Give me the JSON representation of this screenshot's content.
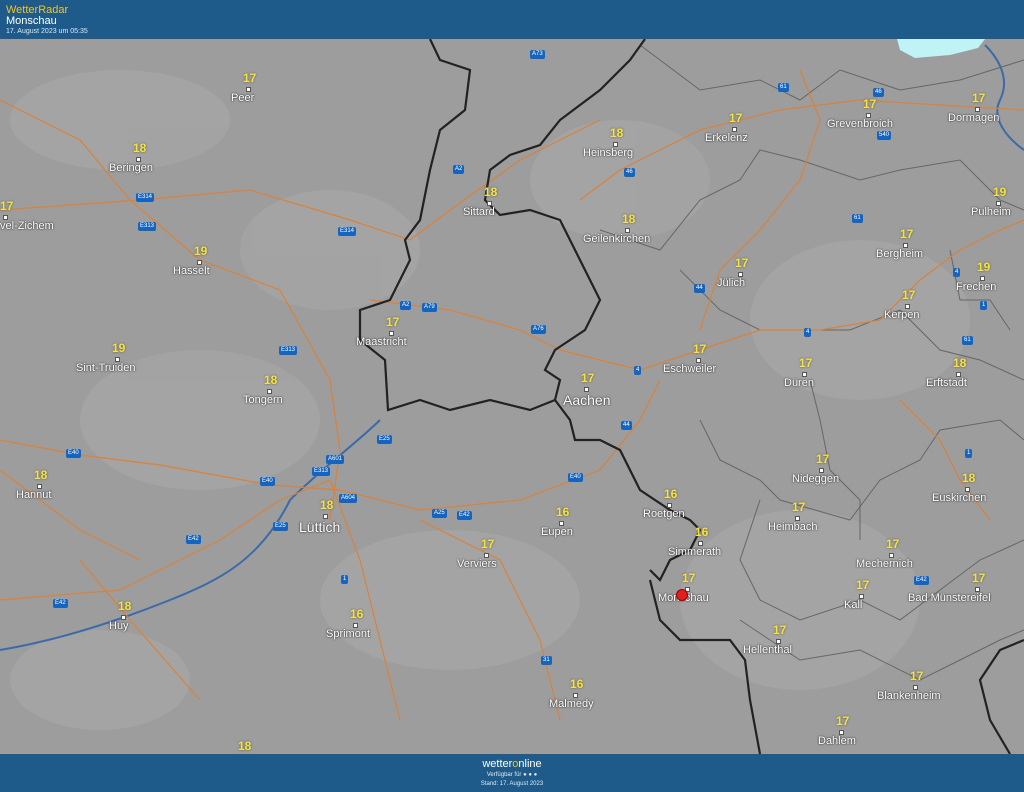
{
  "header": {
    "brand": "WetterRadar",
    "location": "Monschau",
    "timestamp": "17. August 2023 um 05:35"
  },
  "footer": {
    "logo_pre": "wetter",
    "logo_o": "o",
    "logo_post": "nline",
    "available": "Verfügbar für ● ● ●",
    "stand": "Stand: 17. August 2023"
  },
  "cities": [
    {
      "name": "Peer",
      "temp": "17"
    },
    {
      "name": "Beringen",
      "temp": "18"
    },
    {
      "name": "Heinsberg",
      "temp": "18"
    },
    {
      "name": "Erkelenz",
      "temp": "17"
    },
    {
      "name": "Grevenbroich",
      "temp": "17"
    },
    {
      "name": "Dormagen",
      "temp": "17"
    },
    {
      "name": "Sittard",
      "temp": "18"
    },
    {
      "name": "Geilenkirchen",
      "temp": "18"
    },
    {
      "name": "Pulheim",
      "temp": "19"
    },
    {
      "name": "Hasselt",
      "temp": "19"
    },
    {
      "name": "Jülich",
      "temp": "17"
    },
    {
      "name": "Bergheim",
      "temp": "17"
    },
    {
      "name": "Frechen",
      "temp": "19"
    },
    {
      "name": "Maastricht",
      "temp": "17"
    },
    {
      "name": "Kerpen",
      "temp": "17"
    },
    {
      "name": "Sint-Truiden",
      "temp": "19"
    },
    {
      "name": "Eschweiler",
      "temp": "17"
    },
    {
      "name": "Tongern",
      "temp": "18"
    },
    {
      "name": "Aachen",
      "temp": "17"
    },
    {
      "name": "Düren",
      "temp": "17"
    },
    {
      "name": "Erftstadt",
      "temp": "18"
    },
    {
      "name": "Hannut",
      "temp": "18"
    },
    {
      "name": "Nideggen",
      "temp": "17"
    },
    {
      "name": "Euskirchen",
      "temp": "18"
    },
    {
      "name": "Roetgen",
      "temp": "16"
    },
    {
      "name": "Lüttich",
      "temp": "18"
    },
    {
      "name": "Eupen",
      "temp": "16"
    },
    {
      "name": "Heimbach",
      "temp": "17"
    },
    {
      "name": "Simmerath",
      "temp": "16"
    },
    {
      "name": "Verviers",
      "temp": "17"
    },
    {
      "name": "Mechernich",
      "temp": "17"
    },
    {
      "name": "Monschau",
      "temp": "17"
    },
    {
      "name": "Kall",
      "temp": "17"
    },
    {
      "name": "Bad Münstereifel",
      "temp": "17"
    },
    {
      "name": "Huy",
      "temp": "18"
    },
    {
      "name": "Sprimont",
      "temp": "16"
    },
    {
      "name": "Hellenthal",
      "temp": "17"
    },
    {
      "name": "Malmedy",
      "temp": "16"
    },
    {
      "name": "Blankenheim",
      "temp": "17"
    },
    {
      "name": "Dahlem",
      "temp": "17"
    },
    {
      "name": "vel-Zichem",
      "temp": "17"
    }
  ],
  "extra_temps": [
    "18"
  ],
  "roads": [
    "A73",
    "61",
    "46",
    "540",
    "A2",
    "46",
    "E314",
    "E313",
    "E314",
    "61",
    "4",
    "A2",
    "A79",
    "A76",
    "44",
    "1",
    "4",
    "61",
    "E313",
    "4",
    "E25",
    "44",
    "A601",
    "E40",
    "E313",
    "E40",
    "E40",
    "A25",
    "E42",
    "A604",
    "E42",
    "E25",
    "E42",
    "1",
    "1",
    "E42",
    "31"
  ]
}
